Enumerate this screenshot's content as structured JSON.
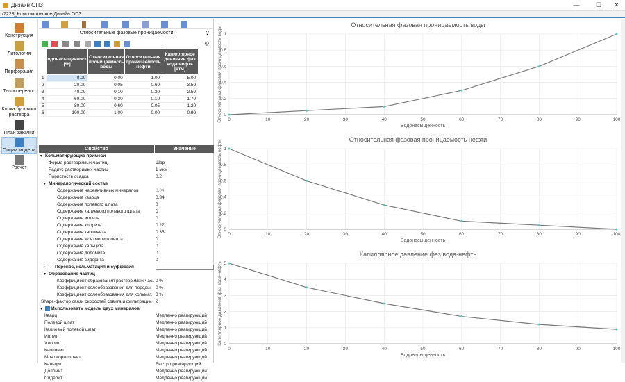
{
  "window": {
    "title": "Дизайн ОПЗ",
    "minimize": "—",
    "maximize": "☐",
    "close": "✕"
  },
  "path": "/7228_Комсомольское/Дизайн ОПЗ",
  "nav": [
    {
      "label": "Конструкция",
      "icon": "construction-icon"
    },
    {
      "label": "Литология",
      "icon": "lithology-icon"
    },
    {
      "label": "Перфорация",
      "icon": "perforation-icon"
    },
    {
      "label": "Теплоперенос",
      "icon": "heat-transfer-icon"
    },
    {
      "label": "Корка бурового раствора",
      "icon": "mud-cake-icon"
    },
    {
      "label": "План закачки",
      "icon": "injection-plan-icon"
    },
    {
      "label": "Опции модели",
      "icon": "model-options-icon"
    },
    {
      "label": "Расчет",
      "icon": "calculation-icon"
    }
  ],
  "section_title": "Относительные фазовые проницаемости",
  "help": "?",
  "table": {
    "headers": [
      "одонасыщенност [%]",
      "Относительная проницаемость воды",
      "Относительная проницаемость нефти",
      "Капиллярное давление фаз вода-нефть [атм]"
    ],
    "rows": [
      {
        "n": "1",
        "sw": "0.00",
        "krw": "0.00",
        "kro": "1.00",
        "pc": "5.00"
      },
      {
        "n": "2",
        "sw": "20.00",
        "krw": "0.05",
        "kro": "0.60",
        "pc": "3.50"
      },
      {
        "n": "3",
        "sw": "40.00",
        "krw": "0.10",
        "kro": "0.30",
        "pc": "2.50"
      },
      {
        "n": "4",
        "sw": "60.00",
        "krw": "0.30",
        "kro": "0.10",
        "pc": "1.70"
      },
      {
        "n": "5",
        "sw": "80.00",
        "krw": "0.60",
        "kro": "0.05",
        "pc": "1.20"
      },
      {
        "n": "6",
        "sw": "100.00",
        "krw": "1.00",
        "kro": "0.00",
        "pc": "0.90"
      }
    ]
  },
  "props_header": {
    "property": "Свойство",
    "value": "Значение"
  },
  "props": [
    {
      "k": "Кольматирующие примеси",
      "v": "",
      "lvl": 0,
      "grp": true,
      "arrow": "▾"
    },
    {
      "k": "Форма растворимых частиц",
      "v": "Шар",
      "lvl": 2
    },
    {
      "k": "Радиус растворимых частиц",
      "v": "1 мкм",
      "lvl": 2
    },
    {
      "k": "Пористость осадка",
      "v": "0.2",
      "lvl": 2
    },
    {
      "k": "Минералогический состав",
      "v": "",
      "lvl": 1,
      "grp": true,
      "arrow": "▾"
    },
    {
      "k": "Содержание нереактивных минералов",
      "v": "0.04",
      "lvl": 3,
      "gray": true
    },
    {
      "k": "Содержание кварца",
      "v": "0.34",
      "lvl": 3
    },
    {
      "k": "Содержание полевого шпата",
      "v": "0",
      "lvl": 3
    },
    {
      "k": "Содержание калиевого полевого шпата",
      "v": "0",
      "lvl": 3
    },
    {
      "k": "Содержание иллита",
      "v": "0",
      "lvl": 3
    },
    {
      "k": "Содержание хлорита",
      "v": "0.27",
      "lvl": 3
    },
    {
      "k": "Содержание каолинита",
      "v": "0.35",
      "lvl": 3
    },
    {
      "k": "Содержание монтмориллонита",
      "v": "0",
      "lvl": 3
    },
    {
      "k": "Содержание кальцита",
      "v": "0",
      "lvl": 3
    },
    {
      "k": "Содержание доломита",
      "v": "0",
      "lvl": 3
    },
    {
      "k": "Содержание сидерита",
      "v": "0",
      "lvl": 3
    },
    {
      "k": "Перенос, кольматация и суффозия",
      "v": "",
      "lvl": 1,
      "grp": true,
      "arrow": "›",
      "check": true,
      "box": true
    },
    {
      "k": "Образование частиц",
      "v": "",
      "lvl": 1,
      "grp": true,
      "arrow": "▾"
    },
    {
      "k": "Коэффициент образования растворимых час...",
      "v": "0 %",
      "lvl": 3
    },
    {
      "k": "Коэффициент солеобразования для породы",
      "v": "0 %",
      "lvl": 3
    },
    {
      "k": "Коэффициент солеобразования для кольмат...",
      "v": "0 %",
      "lvl": 3
    },
    {
      "k": "Shape-фактор связи скоростей сдвига и фильтрации",
      "v": "2",
      "lvl": 0
    },
    {
      "k": "Использовать модель двух минералов",
      "v": "",
      "lvl": 0,
      "grp": true,
      "arrow": "▾",
      "check": true,
      "checked": true
    },
    {
      "k": "Кварц",
      "v": "Медленно реагирующий",
      "lvl": 1
    },
    {
      "k": "Полевой шпат",
      "v": "Медленно реагирующий",
      "lvl": 1
    },
    {
      "k": "Калиевый полевой шпат",
      "v": "Медленно реагирующий",
      "lvl": 1
    },
    {
      "k": "Иллит",
      "v": "Медленно реагирующий",
      "lvl": 1
    },
    {
      "k": "Хлорит",
      "v": "Медленно реагирующий",
      "lvl": 1
    },
    {
      "k": "Каолинит",
      "v": "Медленно реагирующий",
      "lvl": 1
    },
    {
      "k": "Монтмориллонит",
      "v": "Медленно реагирующий",
      "lvl": 1
    },
    {
      "k": "Кальцит",
      "v": "Быстро реагирующий",
      "lvl": 1
    },
    {
      "k": "Доломит",
      "v": "Медленно реагирующий",
      "lvl": 1
    },
    {
      "k": "Сидерит",
      "v": "Медленно реагирующий",
      "lvl": 1
    }
  ],
  "chart_data": [
    {
      "type": "line",
      "title": "Относительная фазовая проницаемость воды",
      "xlabel": "Водонасыщенность",
      "ylabel": "Относительная фазовая проницаемость воды",
      "x": [
        0,
        20,
        40,
        60,
        80,
        100
      ],
      "y": [
        0,
        0.05,
        0.1,
        0.3,
        0.6,
        1.0
      ],
      "xlim": [
        0,
        100
      ],
      "ylim": [
        0,
        1
      ],
      "xticks": [
        "0",
        "10",
        "20",
        "30",
        "40",
        "50",
        "60",
        "70",
        "80",
        "90",
        "100"
      ],
      "yticks": [
        "0",
        "0.2",
        "0.4",
        "0.6",
        "0.8",
        "1"
      ],
      "grid": true
    },
    {
      "type": "line",
      "title": "Относительная фазовая проницаемость нефти",
      "xlabel": "Водонасыщенность",
      "ylabel": "Относительная фазовая проницаемость нефти",
      "x": [
        0,
        20,
        40,
        60,
        80,
        100
      ],
      "y": [
        1.0,
        0.6,
        0.3,
        0.1,
        0.05,
        0
      ],
      "xlim": [
        0,
        100
      ],
      "ylim": [
        0,
        1
      ],
      "xticks": [
        "0",
        "10",
        "20",
        "30",
        "40",
        "50",
        "60",
        "70",
        "80",
        "90",
        "100"
      ],
      "yticks": [
        "0",
        "0.2",
        "0.4",
        "0.6",
        "0.8",
        "1"
      ],
      "grid": true
    },
    {
      "type": "line",
      "title": "Капиллярное давление фаз вода-нефть",
      "xlabel": "Водонасыщенность",
      "ylabel": "Капиллярное давление фаз вода-нефть",
      "x": [
        0,
        20,
        40,
        60,
        80,
        100
      ],
      "y": [
        5.0,
        3.5,
        2.5,
        1.7,
        1.2,
        0.9
      ],
      "xlim": [
        0,
        100
      ],
      "ylim": [
        0,
        5
      ],
      "xticks": [
        "0",
        "10",
        "20",
        "30",
        "40",
        "50",
        "60",
        "70",
        "80",
        "90",
        "100"
      ],
      "yticks": [
        "0",
        "1",
        "2",
        "3",
        "4",
        "5"
      ],
      "grid": true
    }
  ],
  "colors": {
    "line": "#7a7a7a",
    "marker": "#5ec9c0",
    "accent": "#3e7fc1",
    "header": "#5a5a5a"
  }
}
